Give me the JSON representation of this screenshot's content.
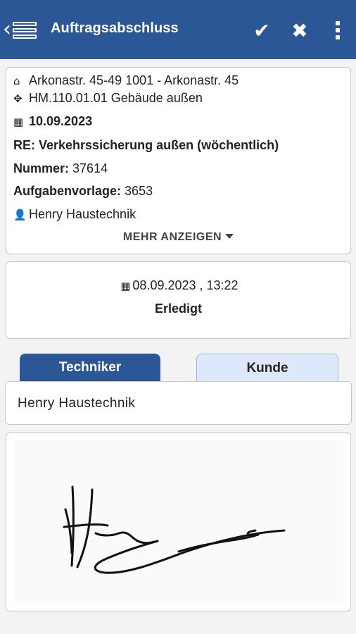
{
  "header": {
    "title": "Auftragsabschluss",
    "back_icon": "chevron-left-icon",
    "list_icon": "list-icon",
    "confirm_icon": "checkmark-icon",
    "cancel_icon": "close-icon",
    "more_icon": "vertical-dots-icon",
    "color": "#2b5797"
  },
  "order": {
    "address": "Arkonastr. 45-49 1001 - Arkonastr. 45",
    "object": "HM.110.01.01 Gebäude außen",
    "date": "10.09.2023",
    "title": "RE: Verkehrssicherung außen (wöchentlich)",
    "number_label": "Nummer:",
    "number_value": "37614",
    "template_label": "Aufgabenvorlage:",
    "template_value": "3653",
    "person": "Henry Haustechnik",
    "more_label": "MEHR ANZEIGEN"
  },
  "status": {
    "datetime": "08.09.2023 , 13:22",
    "state": "Erledigt"
  },
  "tabs": [
    {
      "label": "Techniker",
      "active": true
    },
    {
      "label": "Kunde",
      "active": false
    }
  ],
  "signer": {
    "name": "Henry Haustechnik"
  },
  "colors": {
    "primary": "#2b5797",
    "tab_inactive": "#dde9fb"
  }
}
